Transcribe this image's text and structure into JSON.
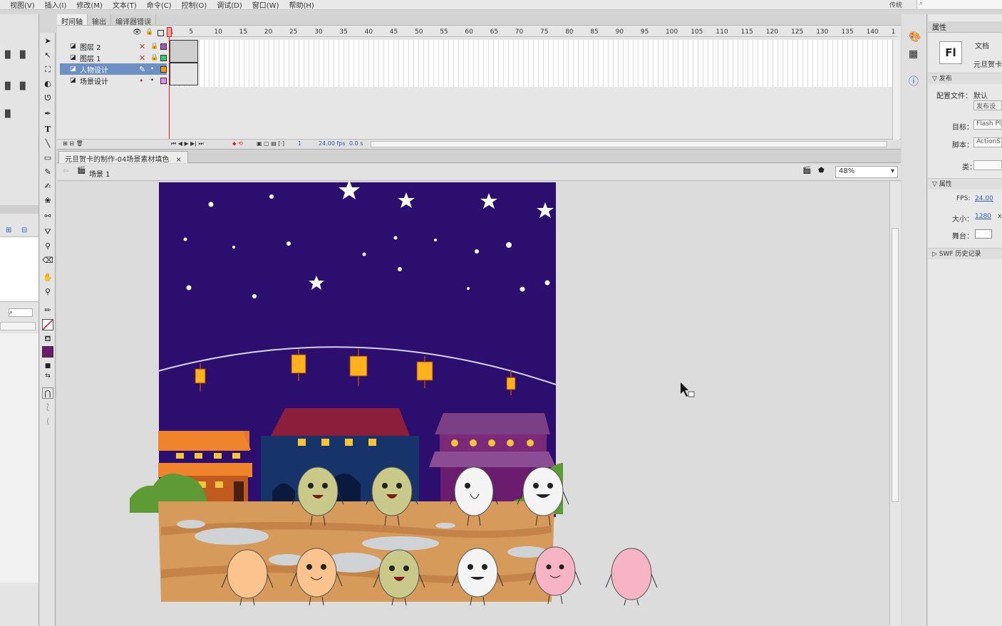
{
  "menu": [
    "视图(V)",
    "插入(I)",
    "修改(M)",
    "文本(T)",
    "命令(C)",
    "控制(O)",
    "调试(D)",
    "窗口(W)",
    "帮助(H)"
  ],
  "workspace": "传统",
  "timeline": {
    "tabs": [
      "时间轴",
      "输出",
      "编译器错误"
    ],
    "ruler": [
      "1",
      "5",
      "10",
      "15",
      "20",
      "25",
      "30",
      "35",
      "40",
      "45",
      "50",
      "55",
      "60",
      "65",
      "70",
      "75",
      "80",
      "85",
      "90",
      "95",
      "100",
      "105",
      "110",
      "115",
      "120",
      "125",
      "130",
      "135",
      "140",
      "1"
    ],
    "layers": [
      {
        "name": "图层 2",
        "selected": false
      },
      {
        "name": "图层 1",
        "selected": false
      },
      {
        "name": "人物设计",
        "selected": true
      },
      {
        "name": "场景设计",
        "selected": false
      }
    ],
    "frame": "1",
    "fps": "24.00 fps",
    "time": "0.0 s"
  },
  "document": {
    "tab": "元旦贺卡的制作-04场景素材填色",
    "scene": "场景 1",
    "zoom": "48%"
  },
  "properties": {
    "title": "属性",
    "doc_type": "文档",
    "doc_name": "元旦贺卡",
    "fl_logo": "Fl",
    "publish_section": "发布",
    "profile_label": "配置文件：",
    "profile_value": "默认",
    "publish_settings": "发布设",
    "target_label": "目标：",
    "target_value": "Flash Pl",
    "script_label": "脚本：",
    "script_value": "ActionS",
    "class_label": "类：",
    "props_section": "属性",
    "fps_label": "FPS:",
    "fps_value": "24.00",
    "size_label": "大小：",
    "size_value": "1280",
    "size_suffix": "x",
    "stage_label": "舞台：",
    "swf_section": "SWF 历史记录"
  },
  "colors": {
    "sky": "#2b0e6e",
    "ground": "#d69a5a",
    "accent": "#6c8fc4"
  }
}
